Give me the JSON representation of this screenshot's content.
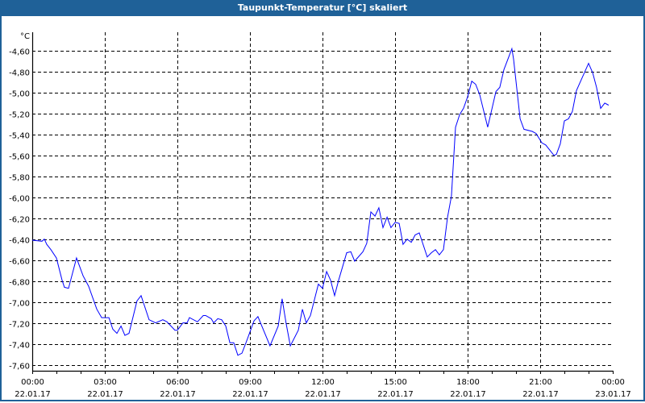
{
  "window": {
    "title": "Taupunkt-Temperatur [°C] skaliert",
    "title_bar_color": "#1f6198"
  },
  "chart_data": {
    "type": "line",
    "title": "Taupunkt-Temperatur [°C] skaliert",
    "ylabel": "°C",
    "xlabel": "",
    "ylim": [
      -7.6,
      -4.6
    ],
    "xlim_hours": [
      0,
      24
    ],
    "grid": true,
    "line_color": "#0000ff",
    "yticks": [
      "-4,60",
      "-4,80",
      "-5,00",
      "-5,20",
      "-5,40",
      "-5,60",
      "-5,80",
      "-6,00",
      "-6,20",
      "-6,40",
      "-6,60",
      "-6,80",
      "-7,00",
      "-7,20",
      "-7,40",
      "-7,60"
    ],
    "ytick_values": [
      -4.6,
      -4.8,
      -5.0,
      -5.2,
      -5.4,
      -5.6,
      -5.8,
      -6.0,
      -6.2,
      -6.4,
      -6.6,
      -6.8,
      -7.0,
      -7.2,
      -7.4,
      -7.6
    ],
    "xticks": [
      {
        "hour": 0,
        "time": "00:00",
        "date": "22.01.17"
      },
      {
        "hour": 3,
        "time": "03:00",
        "date": "22.01.17"
      },
      {
        "hour": 6,
        "time": "06:00",
        "date": "22.01.17"
      },
      {
        "hour": 9,
        "time": "09:00",
        "date": "22.01.17"
      },
      {
        "hour": 12,
        "time": "12:00",
        "date": "22.01.17"
      },
      {
        "hour": 15,
        "time": "15:00",
        "date": "22.01.17"
      },
      {
        "hour": 18,
        "time": "18:00",
        "date": "22.01.17"
      },
      {
        "hour": 21,
        "time": "21:00",
        "date": "22.01.17"
      },
      {
        "hour": 24,
        "time": "00:00",
        "date": "23.01.17"
      }
    ],
    "series": [
      {
        "name": "Taupunkt-Temperatur",
        "points": [
          [
            0,
            -6.41
          ],
          [
            0.4,
            -6.42
          ],
          [
            0.5,
            -6.4
          ],
          [
            0.6,
            -6.45
          ],
          [
            0.77,
            -6.5
          ],
          [
            1.0,
            -6.58
          ],
          [
            1.23,
            -6.79
          ],
          [
            1.33,
            -6.86
          ],
          [
            1.5,
            -6.87
          ],
          [
            1.83,
            -6.58
          ],
          [
            2.1,
            -6.75
          ],
          [
            2.33,
            -6.85
          ],
          [
            2.67,
            -7.07
          ],
          [
            2.87,
            -7.15
          ],
          [
            3.17,
            -7.15
          ],
          [
            3.33,
            -7.26
          ],
          [
            3.5,
            -7.3
          ],
          [
            3.67,
            -7.23
          ],
          [
            3.83,
            -7.32
          ],
          [
            4.0,
            -7.3
          ],
          [
            4.33,
            -6.99
          ],
          [
            4.5,
            -6.94
          ],
          [
            4.83,
            -7.17
          ],
          [
            5.1,
            -7.2
          ],
          [
            5.4,
            -7.17
          ],
          [
            5.57,
            -7.19
          ],
          [
            5.9,
            -7.27
          ],
          [
            6.0,
            -7.27
          ],
          [
            6.23,
            -7.2
          ],
          [
            6.4,
            -7.2
          ],
          [
            6.5,
            -7.15
          ],
          [
            6.83,
            -7.19
          ],
          [
            7.07,
            -7.13
          ],
          [
            7.17,
            -7.13
          ],
          [
            7.4,
            -7.16
          ],
          [
            7.5,
            -7.2
          ],
          [
            7.67,
            -7.16
          ],
          [
            7.83,
            -7.17
          ],
          [
            8.0,
            -7.23
          ],
          [
            8.17,
            -7.39
          ],
          [
            8.33,
            -7.39
          ],
          [
            8.5,
            -7.51
          ],
          [
            8.67,
            -7.49
          ],
          [
            8.87,
            -7.37
          ],
          [
            9.17,
            -7.18
          ],
          [
            9.33,
            -7.14
          ],
          [
            9.83,
            -7.42
          ],
          [
            10.17,
            -7.23
          ],
          [
            10.33,
            -6.97
          ],
          [
            10.5,
            -7.21
          ],
          [
            10.67,
            -7.42
          ],
          [
            11.0,
            -7.27
          ],
          [
            11.17,
            -7.07
          ],
          [
            11.33,
            -7.2
          ],
          [
            11.5,
            -7.13
          ],
          [
            11.83,
            -6.83
          ],
          [
            12.0,
            -6.87
          ],
          [
            12.17,
            -6.71
          ],
          [
            12.33,
            -6.79
          ],
          [
            12.5,
            -6.94
          ],
          [
            12.67,
            -6.79
          ],
          [
            13.0,
            -6.53
          ],
          [
            13.17,
            -6.52
          ],
          [
            13.33,
            -6.61
          ],
          [
            13.67,
            -6.52
          ],
          [
            13.83,
            -6.44
          ],
          [
            14.0,
            -6.14
          ],
          [
            14.17,
            -6.18
          ],
          [
            14.33,
            -6.1
          ],
          [
            14.5,
            -6.29
          ],
          [
            14.67,
            -6.19
          ],
          [
            14.83,
            -6.29
          ],
          [
            15.0,
            -6.24
          ],
          [
            15.17,
            -6.25
          ],
          [
            15.33,
            -6.45
          ],
          [
            15.5,
            -6.4
          ],
          [
            15.67,
            -6.43
          ],
          [
            15.83,
            -6.36
          ],
          [
            16.0,
            -6.34
          ],
          [
            16.33,
            -6.57
          ],
          [
            16.5,
            -6.53
          ],
          [
            16.67,
            -6.5
          ],
          [
            16.83,
            -6.55
          ],
          [
            17.0,
            -6.5
          ],
          [
            17.17,
            -6.19
          ],
          [
            17.33,
            -5.99
          ],
          [
            17.5,
            -5.33
          ],
          [
            17.67,
            -5.21
          ],
          [
            17.83,
            -5.15
          ],
          [
            18.0,
            -5.04
          ],
          [
            18.17,
            -4.89
          ],
          [
            18.33,
            -4.92
          ],
          [
            18.5,
            -5.02
          ],
          [
            18.83,
            -5.33
          ],
          [
            19.17,
            -4.99
          ],
          [
            19.33,
            -4.95
          ],
          [
            19.5,
            -4.78
          ],
          [
            19.83,
            -4.58
          ],
          [
            19.9,
            -4.68
          ],
          [
            20.17,
            -5.25
          ],
          [
            20.33,
            -5.35
          ],
          [
            20.67,
            -5.37
          ],
          [
            20.83,
            -5.39
          ],
          [
            21.07,
            -5.48
          ],
          [
            21.23,
            -5.5
          ],
          [
            21.57,
            -5.6
          ],
          [
            21.67,
            -5.59
          ],
          [
            21.83,
            -5.49
          ],
          [
            22.0,
            -5.27
          ],
          [
            22.17,
            -5.25
          ],
          [
            22.33,
            -5.18
          ],
          [
            22.5,
            -4.98
          ],
          [
            23.0,
            -4.72
          ],
          [
            23.17,
            -4.81
          ],
          [
            23.33,
            -4.95
          ],
          [
            23.5,
            -5.15
          ],
          [
            23.67,
            -5.1
          ],
          [
            23.83,
            -5.12
          ]
        ]
      }
    ]
  }
}
